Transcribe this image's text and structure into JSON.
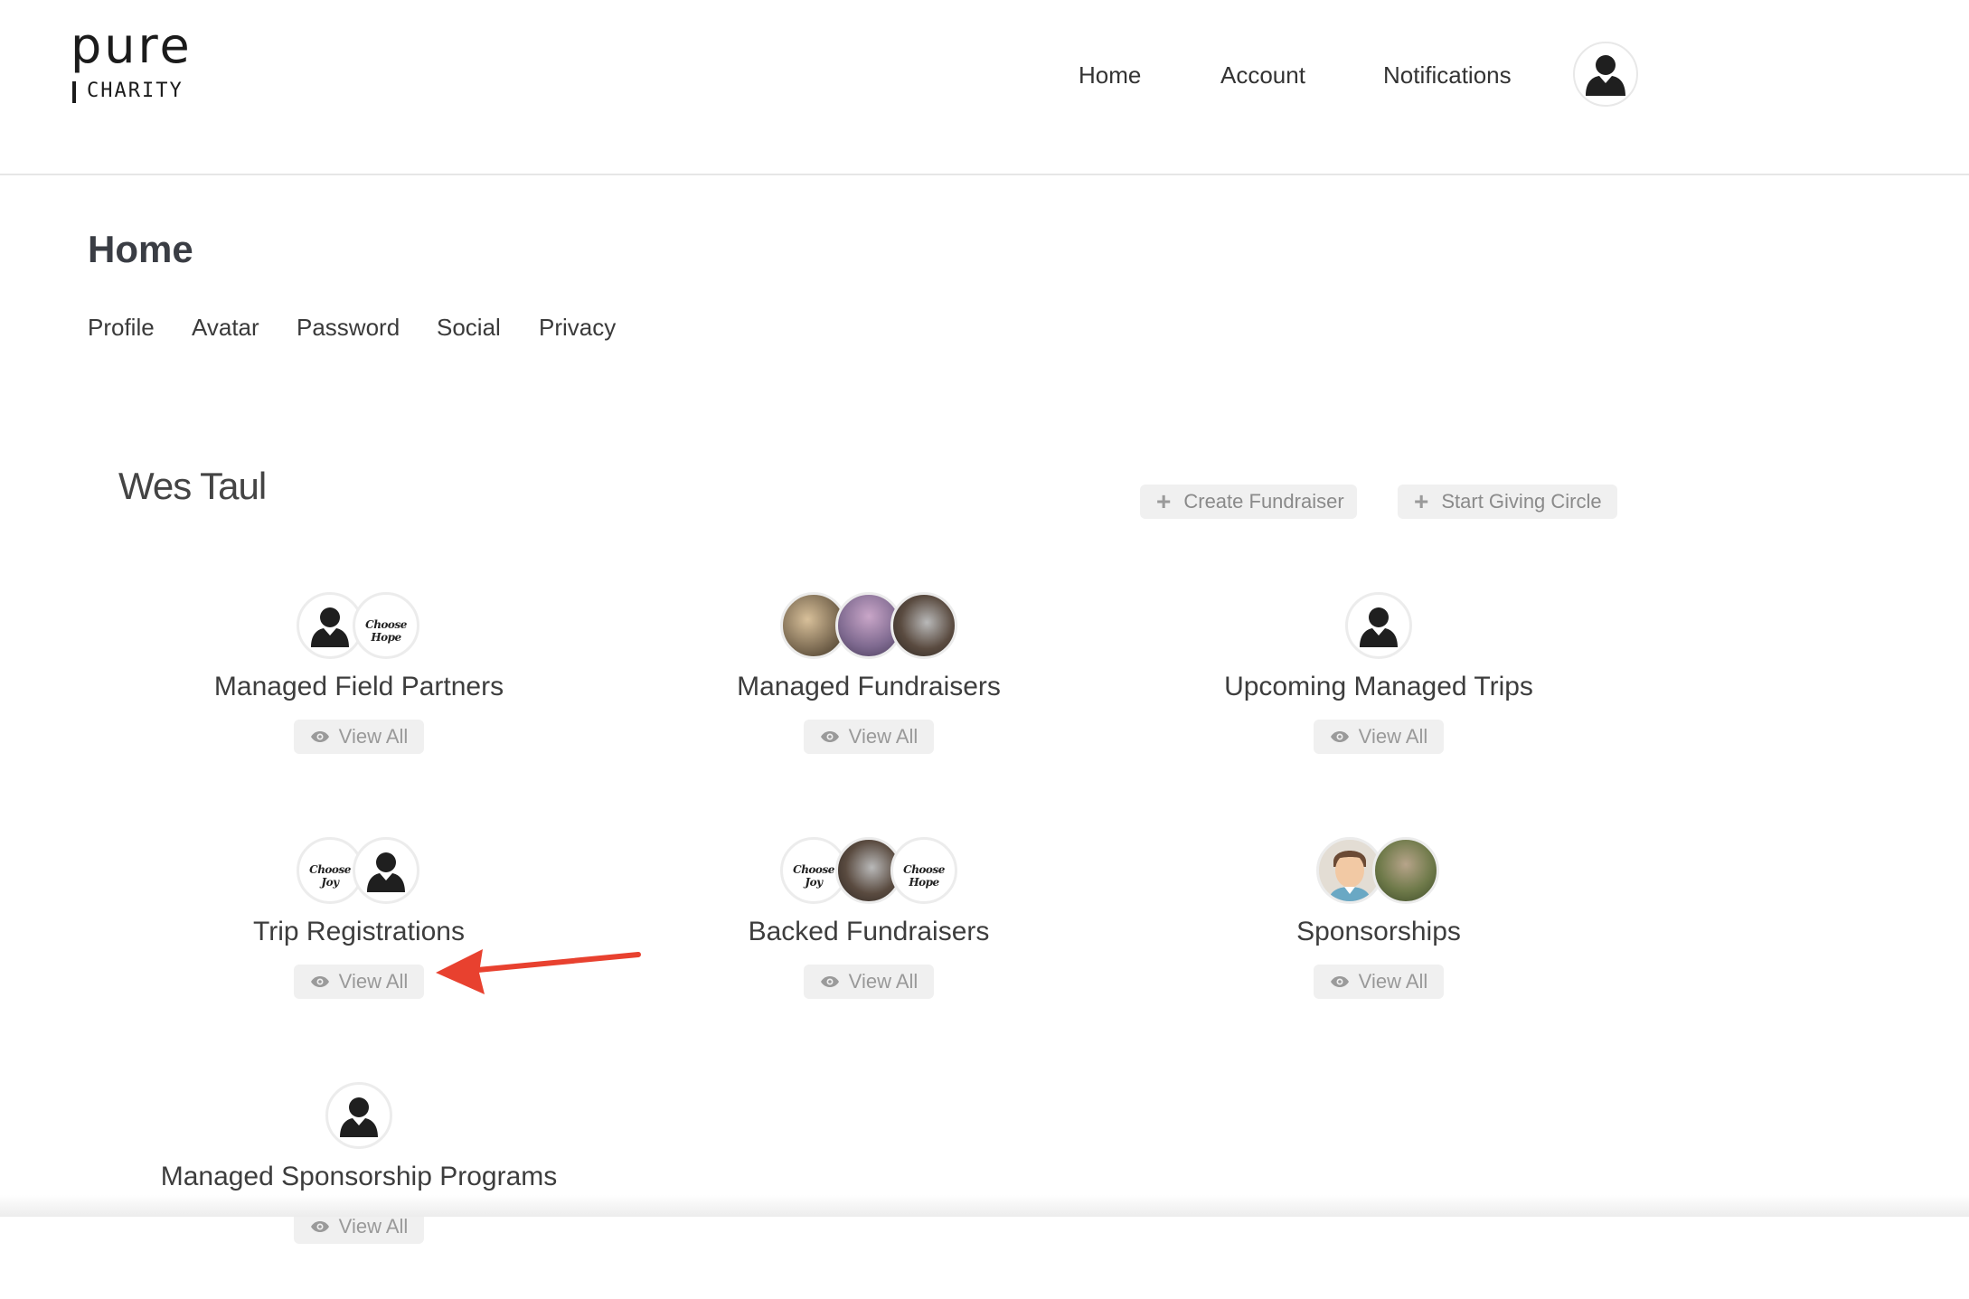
{
  "header": {
    "logo_top": "pure",
    "logo_bottom": "CHARITY",
    "nav": [
      "Home",
      "Account",
      "Notifications"
    ],
    "avatar_icon": "person-silhouette-icon"
  },
  "page": {
    "title": "Home",
    "subnav": [
      "Profile",
      "Avatar",
      "Password",
      "Social",
      "Privacy"
    ]
  },
  "profile": {
    "name": "Wes Taul",
    "actions": [
      {
        "label": "Create Fundraiser",
        "icon": "plus-icon"
      },
      {
        "label": "Start Giving Circle",
        "icon": "plus-icon"
      }
    ]
  },
  "cards": [
    {
      "title": "Managed Field Partners",
      "view_label": "View All",
      "avatar_texts": [
        "",
        "Choose Hope"
      ]
    },
    {
      "title": "Managed Fundraisers",
      "view_label": "View All"
    },
    {
      "title": "Upcoming Managed Trips",
      "view_label": "View All"
    },
    {
      "title": "Trip Registrations",
      "view_label": "View All",
      "avatar_texts": [
        "Choose Joy",
        ""
      ]
    },
    {
      "title": "Backed Fundraisers",
      "view_label": "View All",
      "avatar_texts": [
        "Choose Joy",
        "",
        "Choose Hope"
      ]
    },
    {
      "title": "Sponsorships",
      "view_label": "View All"
    },
    {
      "title": "Managed Sponsorship Programs",
      "view_label": "View All"
    }
  ],
  "colors": {
    "accent_arrow": "#e8412f",
    "button_bg": "#f0f0f0",
    "button_text": "#999999"
  }
}
